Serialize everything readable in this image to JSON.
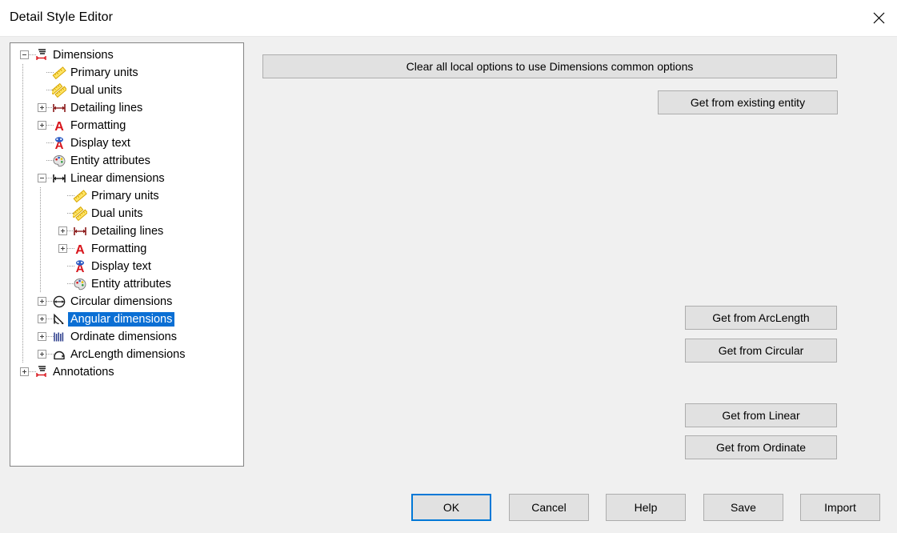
{
  "window": {
    "title": "Detail Style Editor",
    "close_icon": "close-icon"
  },
  "tree": {
    "selected": "Angular dimensions",
    "selection_color": "#0b6fd4",
    "items": [
      {
        "label": "Dimensions",
        "level": 0,
        "toggle": "minus",
        "icon": "dimensions-icon"
      },
      {
        "label": "Primary units",
        "level": 1,
        "toggle": "none",
        "icon": "ruler-icon"
      },
      {
        "label": "Dual units",
        "level": 1,
        "toggle": "none",
        "icon": "dual-ruler-icon"
      },
      {
        "label": "Detailing lines",
        "level": 1,
        "toggle": "plus",
        "icon": "detailing-lines-icon"
      },
      {
        "label": "Formatting",
        "level": 1,
        "toggle": "plus",
        "icon": "formatting-a-icon"
      },
      {
        "label": "Display text",
        "level": 1,
        "toggle": "none",
        "icon": "display-text-icon"
      },
      {
        "label": "Entity attributes",
        "level": 1,
        "toggle": "none",
        "icon": "palette-icon"
      },
      {
        "label": "Linear dimensions",
        "level": 1,
        "toggle": "minus",
        "icon": "linear-dimensions-icon"
      },
      {
        "label": "Primary units",
        "level": 2,
        "toggle": "none",
        "icon": "ruler-icon"
      },
      {
        "label": "Dual units",
        "level": 2,
        "toggle": "none",
        "icon": "dual-ruler-icon"
      },
      {
        "label": "Detailing lines",
        "level": 2,
        "toggle": "plus",
        "icon": "detailing-lines-icon"
      },
      {
        "label": "Formatting",
        "level": 2,
        "toggle": "plus",
        "icon": "formatting-a-icon"
      },
      {
        "label": "Display text",
        "level": 2,
        "toggle": "none",
        "icon": "display-text-icon"
      },
      {
        "label": "Entity attributes",
        "level": 2,
        "toggle": "none",
        "icon": "palette-icon"
      },
      {
        "label": "Circular dimensions",
        "level": 1,
        "toggle": "plus",
        "icon": "circular-dimensions-icon"
      },
      {
        "label": "Angular dimensions",
        "level": 1,
        "toggle": "plus",
        "icon": "angular-dimensions-icon"
      },
      {
        "label": "Ordinate dimensions",
        "level": 1,
        "toggle": "plus",
        "icon": "ordinate-dimensions-icon"
      },
      {
        "label": "ArcLength dimensions",
        "level": 1,
        "toggle": "plus",
        "icon": "arclength-dimensions-icon"
      },
      {
        "label": "Annotations",
        "level": 0,
        "toggle": "plus",
        "icon": "annotations-icon"
      }
    ]
  },
  "actions": {
    "clear_all": "Clear all local options to use Dimensions common options",
    "get_existing_entity": "Get from existing entity",
    "get_arclength": "Get from ArcLength",
    "get_circular": "Get from Circular",
    "get_linear": "Get from Linear",
    "get_ordinate": "Get from Ordinate"
  },
  "footer": {
    "ok": "OK",
    "cancel": "Cancel",
    "help": "Help",
    "save": "Save",
    "import": "Import",
    "focus_color": "#0078d7"
  }
}
